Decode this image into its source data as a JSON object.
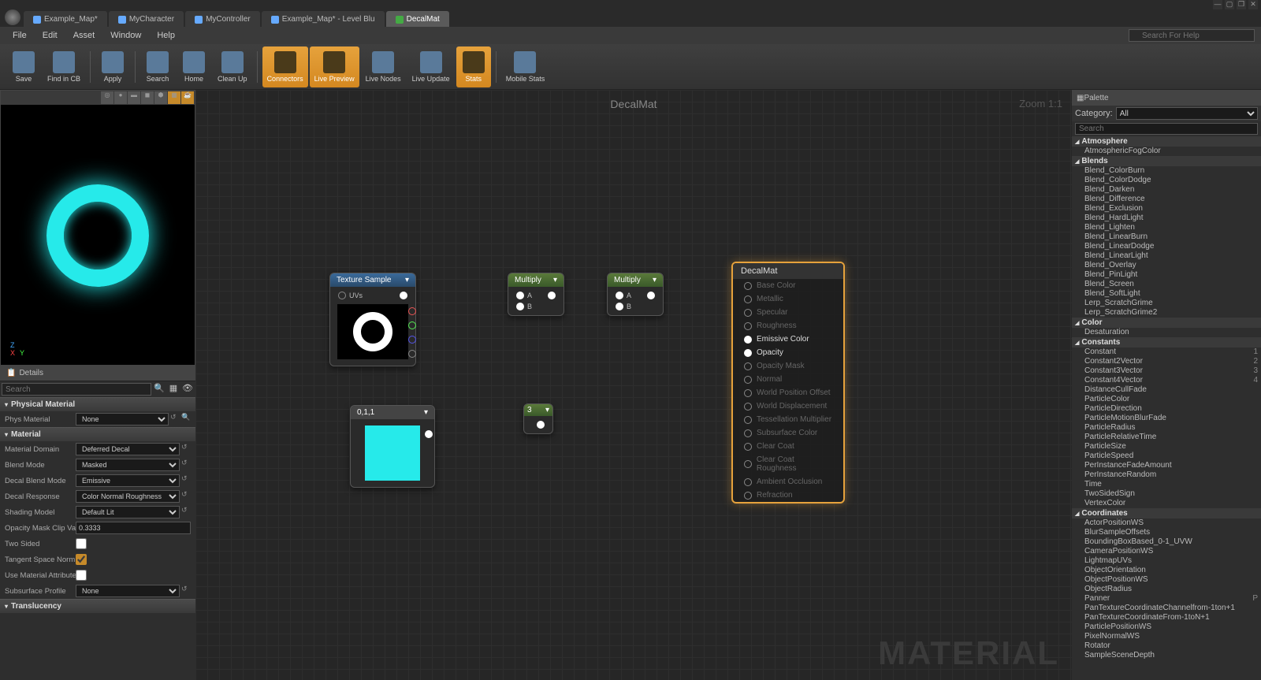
{
  "window": {
    "help_placeholder": "Search For Help"
  },
  "tabs": [
    {
      "label": "Example_Map*"
    },
    {
      "label": "MyCharacter"
    },
    {
      "label": "MyController"
    },
    {
      "label": "Example_Map* - Level Blu"
    },
    {
      "label": "DecalMat"
    }
  ],
  "menu": [
    "File",
    "Edit",
    "Asset",
    "Window",
    "Help"
  ],
  "toolbar": [
    {
      "label": "Save",
      "active": false
    },
    {
      "label": "Find in CB",
      "active": false
    },
    {
      "label": "Apply",
      "active": false
    },
    {
      "label": "Search",
      "active": false
    },
    {
      "label": "Home",
      "active": false
    },
    {
      "label": "Clean Up",
      "active": false
    },
    {
      "label": "Connectors",
      "active": true
    },
    {
      "label": "Live Preview",
      "active": true
    },
    {
      "label": "Live Nodes",
      "active": false
    },
    {
      "label": "Live Update",
      "active": false
    },
    {
      "label": "Stats",
      "active": true
    },
    {
      "label": "Mobile Stats",
      "active": false
    }
  ],
  "graph": {
    "title": "DecalMat",
    "zoom": "Zoom 1:1",
    "watermark": "MATERIAL"
  },
  "nodes": {
    "texture": {
      "title": "Texture Sample",
      "in_label": "UVs"
    },
    "mult1": {
      "title": "Multiply",
      "a": "A",
      "b": "B"
    },
    "mult2": {
      "title": "Multiply",
      "a": "A",
      "b": "B"
    },
    "color": {
      "title": "0,1,1"
    },
    "scalar": {
      "title": "3"
    },
    "result": {
      "title": "DecalMat",
      "pins": [
        {
          "label": "Base Color",
          "active": false
        },
        {
          "label": "Metallic",
          "active": false
        },
        {
          "label": "Specular",
          "active": false
        },
        {
          "label": "Roughness",
          "active": false
        },
        {
          "label": "Emissive Color",
          "active": true
        },
        {
          "label": "Opacity",
          "active": true
        },
        {
          "label": "Opacity Mask",
          "active": false
        },
        {
          "label": "Normal",
          "active": false
        },
        {
          "label": "World Position Offset",
          "active": false
        },
        {
          "label": "World Displacement",
          "active": false
        },
        {
          "label": "Tessellation Multiplier",
          "active": false
        },
        {
          "label": "Subsurface Color",
          "active": false
        },
        {
          "label": "Clear Coat",
          "active": false
        },
        {
          "label": "Clear Coat Roughness",
          "active": false
        },
        {
          "label": "Ambient Occlusion",
          "active": false
        },
        {
          "label": "Refraction",
          "active": false
        }
      ]
    }
  },
  "details": {
    "tab": "Details",
    "search_placeholder": "Search",
    "sections": {
      "physmat": {
        "title": "Physical Material",
        "prop_label": "Phys Material",
        "value": "None"
      },
      "material": {
        "title": "Material",
        "rows": [
          {
            "label": "Material Domain",
            "value": "Deferred Decal",
            "type": "select"
          },
          {
            "label": "Blend Mode",
            "value": "Masked",
            "type": "select"
          },
          {
            "label": "Decal Blend Mode",
            "value": "Emissive",
            "type": "select"
          },
          {
            "label": "Decal Response",
            "value": "Color Normal Roughness",
            "type": "select"
          },
          {
            "label": "Shading Model",
            "value": "Default Lit",
            "type": "select"
          },
          {
            "label": "Opacity Mask Clip Va",
            "value": "0.3333",
            "type": "text"
          },
          {
            "label": "Two Sided",
            "value": "",
            "type": "check",
            "checked": false
          },
          {
            "label": "Tangent Space Norm",
            "value": "",
            "type": "check",
            "checked": true
          },
          {
            "label": "Use Material Attribute",
            "value": "",
            "type": "check",
            "checked": false
          },
          {
            "label": "Subsurface Profile",
            "value": "None",
            "type": "select"
          }
        ]
      },
      "trans": {
        "title": "Translucency"
      }
    }
  },
  "palette": {
    "title": "Palette",
    "category_label": "Category:",
    "category": "All",
    "search_placeholder": "Search",
    "sections": [
      {
        "title": "Atmosphere",
        "items": [
          {
            "label": "AtmosphericFogColor"
          }
        ]
      },
      {
        "title": "Blends",
        "items": [
          {
            "label": "Blend_ColorBurn"
          },
          {
            "label": "Blend_ColorDodge"
          },
          {
            "label": "Blend_Darken"
          },
          {
            "label": "Blend_Difference"
          },
          {
            "label": "Blend_Exclusion"
          },
          {
            "label": "Blend_HardLight"
          },
          {
            "label": "Blend_Lighten"
          },
          {
            "label": "Blend_LinearBurn"
          },
          {
            "label": "Blend_LinearDodge"
          },
          {
            "label": "Blend_LinearLight"
          },
          {
            "label": "Blend_Overlay"
          },
          {
            "label": "Blend_PinLight"
          },
          {
            "label": "Blend_Screen"
          },
          {
            "label": "Blend_SoftLight"
          },
          {
            "label": "Lerp_ScratchGrime"
          },
          {
            "label": "Lerp_ScratchGrime2"
          }
        ]
      },
      {
        "title": "Color",
        "items": [
          {
            "label": "Desaturation"
          }
        ]
      },
      {
        "title": "Constants",
        "items": [
          {
            "label": "Constant",
            "key": "1"
          },
          {
            "label": "Constant2Vector",
            "key": "2"
          },
          {
            "label": "Constant3Vector",
            "key": "3"
          },
          {
            "label": "Constant4Vector",
            "key": "4"
          },
          {
            "label": "DistanceCullFade"
          },
          {
            "label": "ParticleColor"
          },
          {
            "label": "ParticleDirection"
          },
          {
            "label": "ParticleMotionBlurFade"
          },
          {
            "label": "ParticleRadius"
          },
          {
            "label": "ParticleRelativeTime"
          },
          {
            "label": "ParticleSize"
          },
          {
            "label": "ParticleSpeed"
          },
          {
            "label": "PerInstanceFadeAmount"
          },
          {
            "label": "PerInstanceRandom"
          },
          {
            "label": "Time"
          },
          {
            "label": "TwoSidedSign"
          },
          {
            "label": "VertexColor"
          }
        ]
      },
      {
        "title": "Coordinates",
        "items": [
          {
            "label": "ActorPositionWS"
          },
          {
            "label": "BlurSampleOffsets"
          },
          {
            "label": "BoundingBoxBased_0-1_UVW"
          },
          {
            "label": "CameraPositionWS"
          },
          {
            "label": "LightmapUVs"
          },
          {
            "label": "ObjectOrientation"
          },
          {
            "label": "ObjectPositionWS"
          },
          {
            "label": "ObjectRadius"
          },
          {
            "label": "Panner",
            "key": "P"
          },
          {
            "label": "PanTextureCoordinateChannelfrom-1ton+1"
          },
          {
            "label": "PanTextureCoordinateFrom-1toN+1"
          },
          {
            "label": "ParticlePositionWS"
          },
          {
            "label": "PixelNormalWS"
          },
          {
            "label": "Rotator"
          },
          {
            "label": "SampleSceneDepth"
          }
        ]
      }
    ]
  }
}
